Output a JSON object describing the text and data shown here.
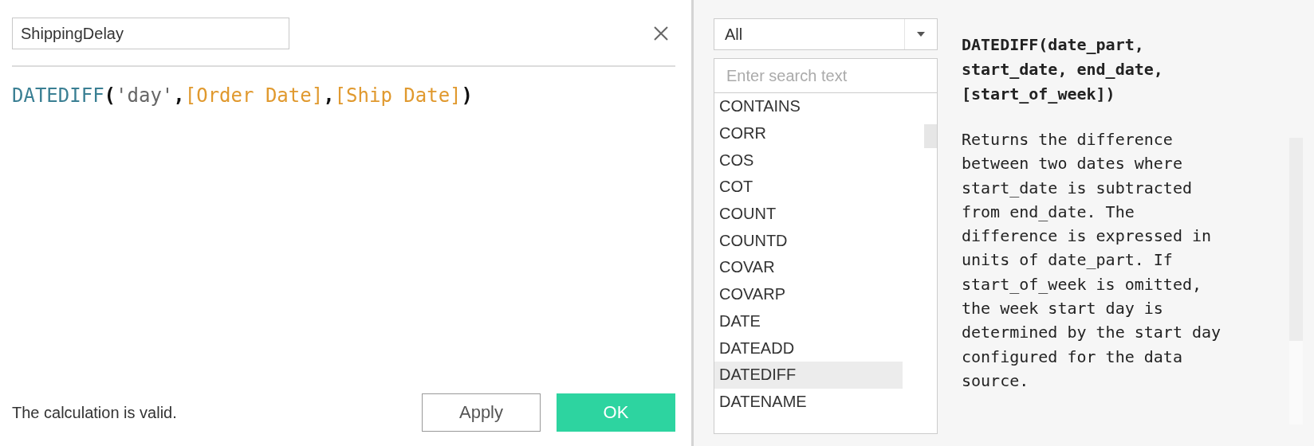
{
  "calculation": {
    "name": "ShippingDelay",
    "formula": [
      {
        "kind": "function",
        "text": "DATEDIFF"
      },
      {
        "kind": "punct",
        "text": "("
      },
      {
        "kind": "string",
        "text": "'day'"
      },
      {
        "kind": "punct",
        "text": ","
      },
      {
        "kind": "field",
        "text": "[Order Date]"
      },
      {
        "kind": "punct",
        "text": ","
      },
      {
        "kind": "field",
        "text": "[Ship Date]"
      },
      {
        "kind": "punct",
        "text": ")"
      }
    ],
    "status": "The calculation is valid.",
    "buttons": [
      {
        "label": "Apply",
        "kind": "secondary"
      },
      {
        "label": "OK",
        "kind": "primary"
      }
    ]
  },
  "functions": {
    "category": "All",
    "search": {
      "placeholder": "Enter search text"
    },
    "items": [
      {
        "label": "CONTAINS",
        "selected": false
      },
      {
        "label": "CORR",
        "selected": false
      },
      {
        "label": "COS",
        "selected": false
      },
      {
        "label": "COT",
        "selected": false
      },
      {
        "label": "COUNT",
        "selected": false
      },
      {
        "label": "COUNTD",
        "selected": false
      },
      {
        "label": "COVAR",
        "selected": false
      },
      {
        "label": "COVARP",
        "selected": false
      },
      {
        "label": "DATE",
        "selected": false
      },
      {
        "label": "DATEADD",
        "selected": false
      },
      {
        "label": "DATEDIFF",
        "selected": true
      },
      {
        "label": "DATENAME",
        "selected": false
      }
    ]
  },
  "help": {
    "signature": "DATEDIFF(date_part, start_date, end_date, [start_of_week])",
    "description": "Returns the difference between two dates where start_date is subtracted from end_date. The difference is expressed in units of date_part. If start_of_week is omitted, the week start day is determined by the start day configured for the data source."
  }
}
